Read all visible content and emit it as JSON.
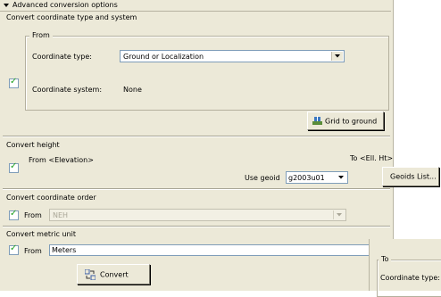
{
  "header": {
    "title": "Advanced conversion options"
  },
  "type_system": {
    "title": "Convert coordinate type and system",
    "from_legend": "From",
    "coordinate_type_label": "Coordinate type:",
    "coordinate_type_value": "Ground or Localization",
    "coordinate_system_label": "Coordinate system:",
    "coordinate_system_value": "None",
    "checked": true,
    "grid_to_ground_label": "Grid to ground"
  },
  "height": {
    "title": "Convert height",
    "from_label": "From <Elevation>",
    "to_label": "To <Ell. Ht>",
    "use_geoid_label": "Use geoid",
    "geoid_value": "g2003u01",
    "geoids_list_label": "Geoids List...",
    "checked": true
  },
  "order": {
    "title": "Convert coordinate order",
    "from_label": "From",
    "from_value": "NEH",
    "checked": true
  },
  "metric": {
    "title": "Convert metric unit",
    "from_label": "From",
    "from_value": "Meters",
    "checked": true
  },
  "convert_button_label": "Convert",
  "fragment": {
    "to_legend": "To",
    "coordinate_type_label": "Coordinate type:"
  },
  "colors": {
    "panel_bg": "#ece9d8",
    "check_mark": "#21a121",
    "field_border": "#7f9db9"
  }
}
